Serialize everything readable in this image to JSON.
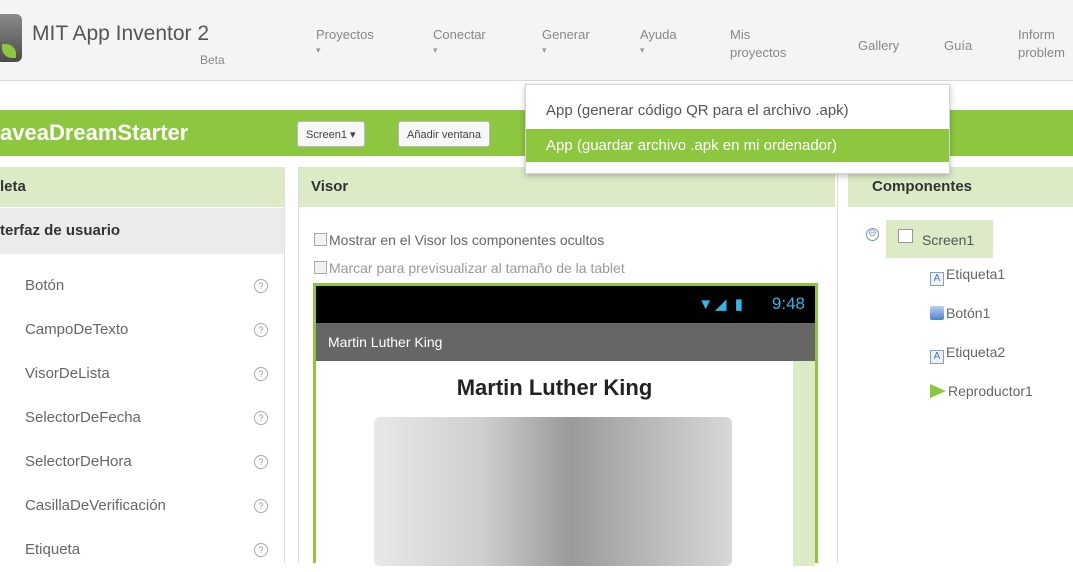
{
  "app": {
    "title": "MIT App Inventor 2",
    "subtitle": "Beta"
  },
  "menu": {
    "items": [
      {
        "label": "Proyectos",
        "arrow": "▾"
      },
      {
        "label": "Conectar",
        "arrow": "▾"
      },
      {
        "label": "Generar",
        "arrow": "▾"
      },
      {
        "label": "Ayuda",
        "arrow": "▾"
      },
      {
        "label": "Mis proyectos"
      },
      {
        "label": "Gallery"
      },
      {
        "label": "Guía"
      },
      {
        "label": "Inform problem"
      }
    ]
  },
  "dropdown": {
    "items": [
      {
        "label": "App (generar código QR para el archivo .apk)"
      },
      {
        "label": "App (guardar archivo .apk en mi ordenador)"
      }
    ]
  },
  "project": {
    "name": "aveaDreamStarter",
    "screen_select": "Screen1 ▾",
    "add_screen": "Añadir ventana"
  },
  "palette": {
    "header": "leta",
    "section": "terfaz de usuario",
    "help_glyph": "?",
    "items": [
      "Botón",
      "CampoDeTexto",
      "VisorDeLista",
      "SelectorDeFecha",
      "SelectorDeHora",
      "CasillaDeVerificación",
      "Etiqueta"
    ]
  },
  "viewer": {
    "header": "Visor",
    "show_hidden": "Mostrar en el Visor los componentes ocultos",
    "tablet_preview": "Marcar para previsualizar al tamaño de la tablet",
    "status_time": "9:48",
    "status_icons": "▼◢ ▮",
    "screen_title": "Martin Luther King",
    "label_text": "Martin Luther King"
  },
  "components": {
    "header": "Componentes",
    "toggle": "⊖",
    "root": "Screen1",
    "children": [
      {
        "label": "Etiqueta1",
        "icon": "label-icon"
      },
      {
        "label": "Botón1",
        "icon": "button-icon"
      },
      {
        "label": "Etiqueta2",
        "icon": "label-icon"
      },
      {
        "label": "Reproductor1",
        "icon": "player-icon"
      }
    ]
  },
  "colors": {
    "accent": "#8dc63f",
    "panel_header": "#dcebc6"
  }
}
